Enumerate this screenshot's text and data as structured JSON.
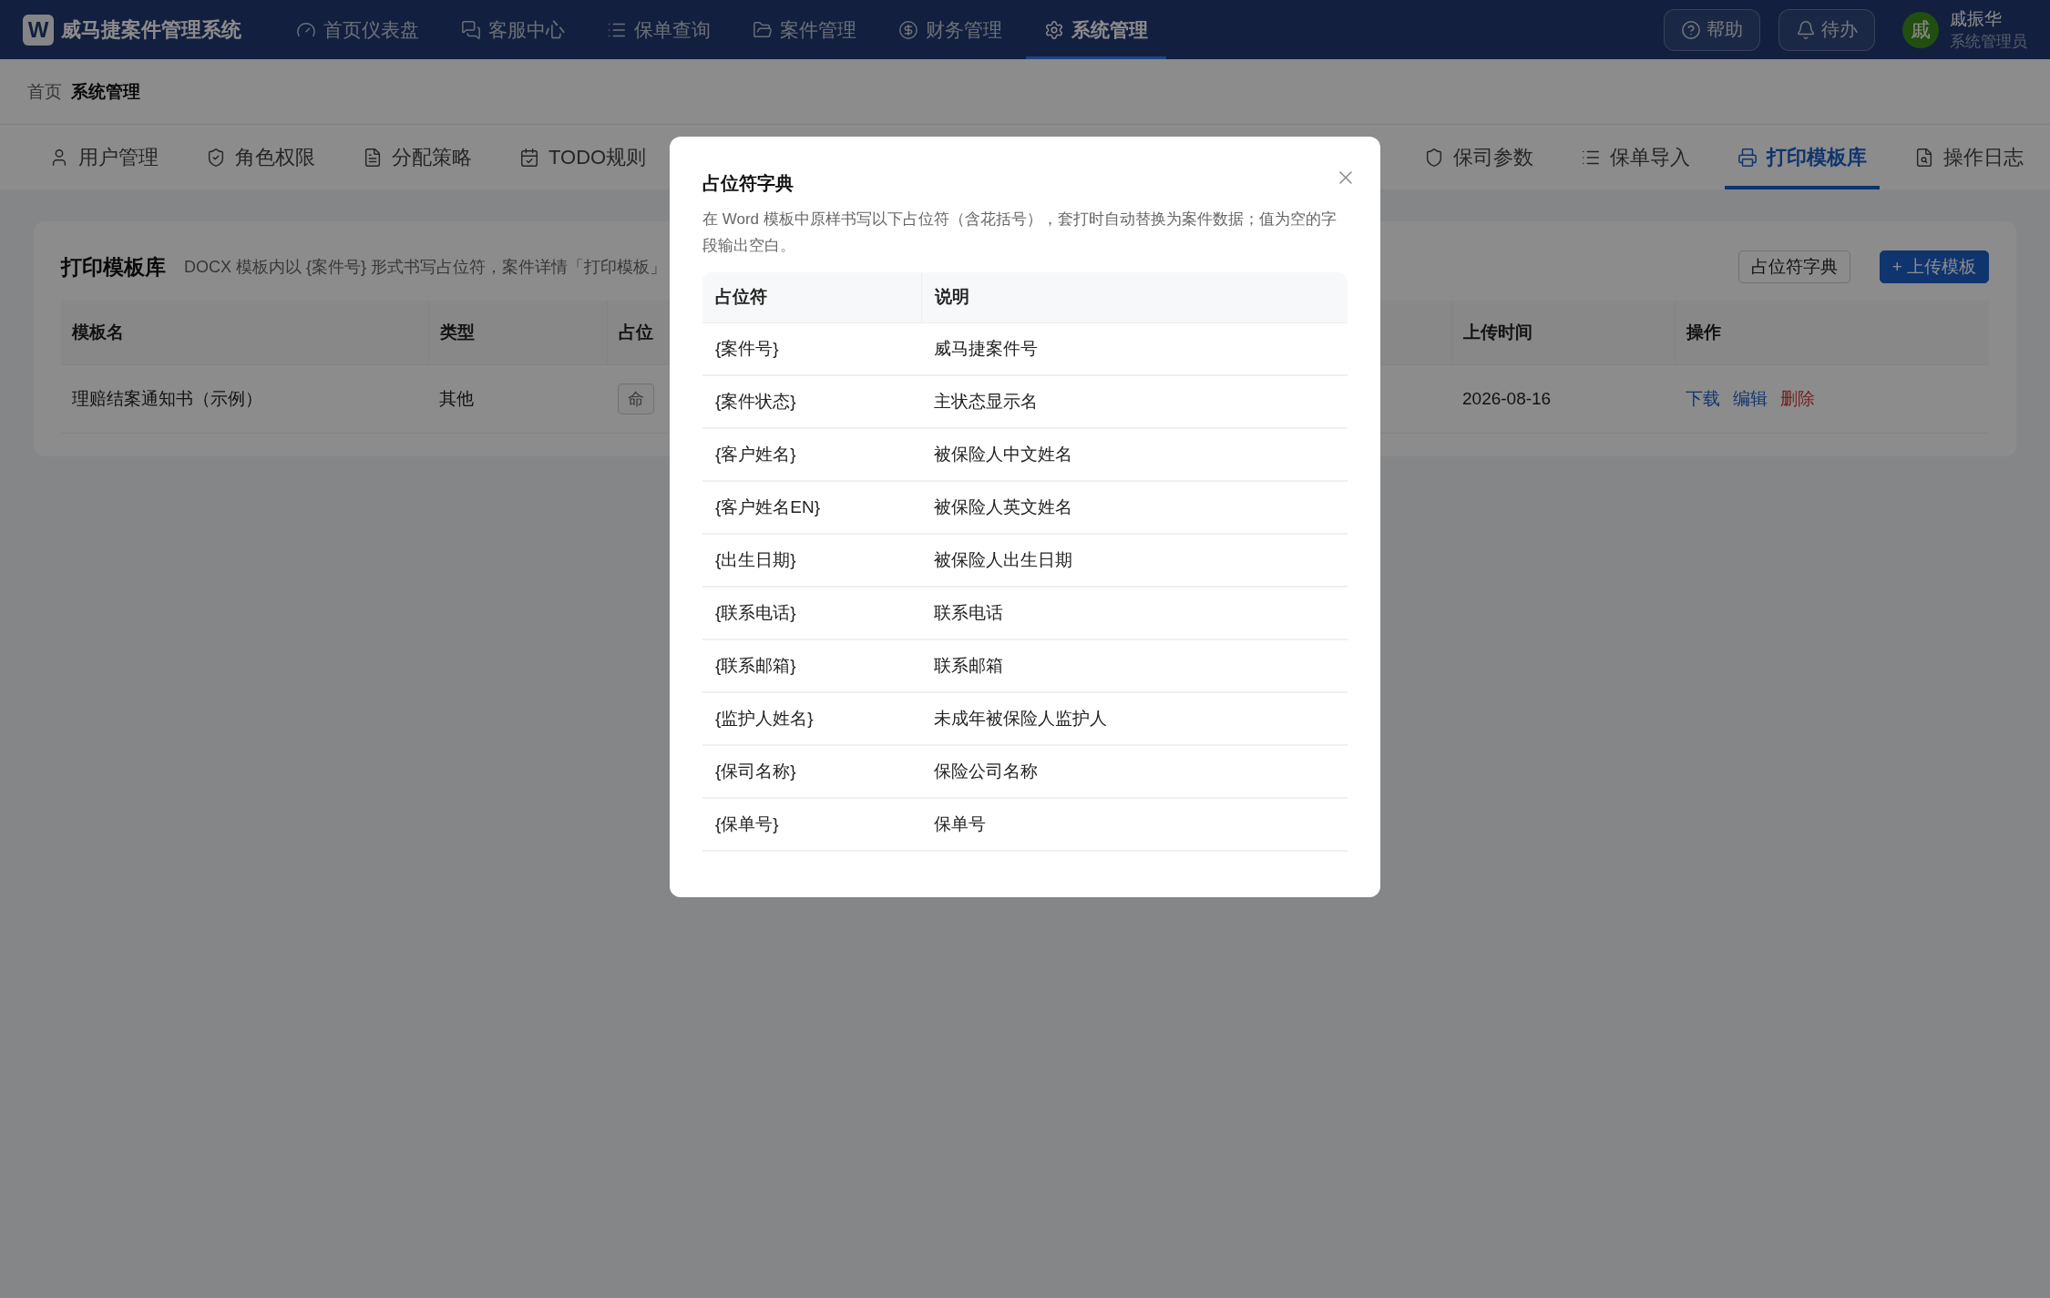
{
  "app": {
    "logo": "W",
    "title": "威马捷案件管理系统"
  },
  "nav": [
    {
      "label": "首页仪表盘",
      "selected": false
    },
    {
      "label": "客服中心",
      "selected": false
    },
    {
      "label": "保单查询",
      "selected": false
    },
    {
      "label": "案件管理",
      "selected": false
    },
    {
      "label": "财务管理",
      "selected": false
    },
    {
      "label": "系统管理",
      "selected": true
    }
  ],
  "header_buttons": [
    "帮助",
    "待办"
  ],
  "user": {
    "avatar": "戚",
    "name": "戚振华",
    "role": "系统管理员"
  },
  "breadcrumb": [
    {
      "label": "首页",
      "current": false
    },
    {
      "label": "系统管理",
      "current": true
    }
  ],
  "tab_groups": [
    [
      {
        "label": "用户管理",
        "selected": false
      },
      {
        "label": "角色权限",
        "selected": false
      },
      {
        "label": "分配策略",
        "selected": false
      },
      {
        "label": "TODO规则",
        "selected": false
      }
    ],
    [
      {
        "label": "保司参数",
        "selected": false
      },
      {
        "label": "保单导入",
        "selected": false
      },
      {
        "label": "打印模板库",
        "selected": true
      },
      {
        "label": "操作日志",
        "selected": false
      }
    ]
  ],
  "card": {
    "title": "打印模板库",
    "description": "DOCX 模板内以 {案件号} 形式书写占位符，案件详情「打印模板」",
    "buttons": [
      {
        "label": "占位符字典",
        "kind": "default"
      },
      {
        "label": "+ 上传模板",
        "kind": "primary"
      }
    ],
    "table": {
      "columns": [
        "模板名",
        "类型",
        "占位",
        "上传时间",
        "操作"
      ],
      "rows": [
        {
          "name": "理赔结案通知书（示例）",
          "type": "其他",
          "tag": "命",
          "uploaded": "2026-08-16",
          "actions": [
            {
              "label": "下载",
              "kind": "link"
            },
            {
              "label": "编辑",
              "kind": "link"
            },
            {
              "label": "删除",
              "kind": "danger"
            }
          ]
        }
      ]
    }
  },
  "modal": {
    "title": "占位符字典",
    "description": "在 Word 模板中原样书写以下占位符（含花括号），套打时自动替换为案件数据；值为空的字段输出空白。",
    "columns": [
      "占位符",
      "说明"
    ],
    "rows": [
      {
        "placeholder": "{案件号}",
        "meaning": "威马捷案件号"
      },
      {
        "placeholder": "{案件状态}",
        "meaning": "主状态显示名"
      },
      {
        "placeholder": "{客户姓名}",
        "meaning": "被保险人中文姓名"
      },
      {
        "placeholder": "{客户姓名EN}",
        "meaning": "被保险人英文姓名"
      },
      {
        "placeholder": "{出生日期}",
        "meaning": "被保险人出生日期"
      },
      {
        "placeholder": "{联系电话}",
        "meaning": "联系电话"
      },
      {
        "placeholder": "{联系邮箱}",
        "meaning": "联系邮箱"
      },
      {
        "placeholder": "{监护人姓名}",
        "meaning": "未成年被保险人监护人"
      },
      {
        "placeholder": "{保司名称}",
        "meaning": "保险公司名称"
      },
      {
        "placeholder": "{保单号}",
        "meaning": "保单号"
      }
    ]
  }
}
